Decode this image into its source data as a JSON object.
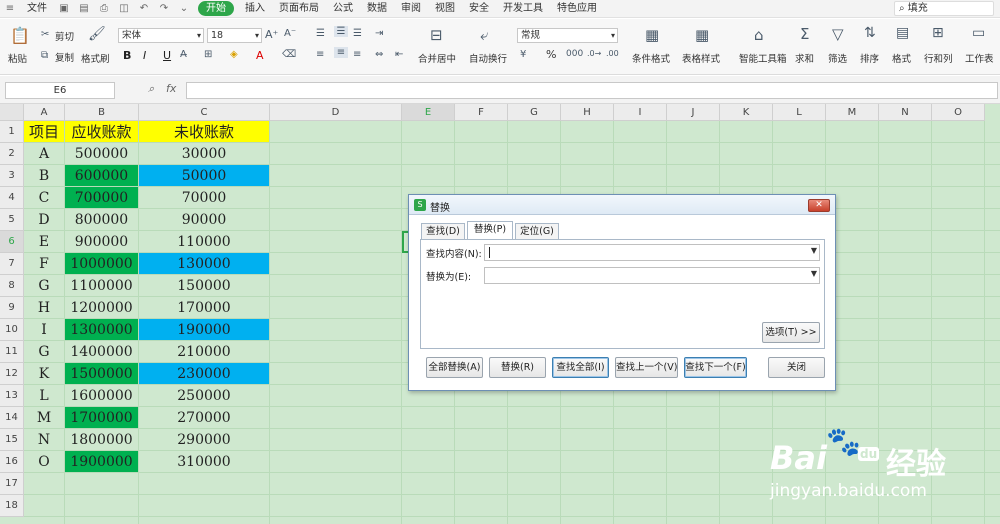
{
  "menubar": {
    "file": "文件",
    "items": [
      "开始",
      "插入",
      "页面布局",
      "公式",
      "数据",
      "审阅",
      "视图",
      "安全",
      "开发工具",
      "特色应用"
    ],
    "search": "填充"
  },
  "ribbon": {
    "paste": "粘贴",
    "cut": "剪切",
    "copy": "复制",
    "format_painter": "格式刷",
    "font": "宋体",
    "font_size": "18",
    "bold": "B",
    "italic": "I",
    "underline": "U",
    "merge": "合并居中",
    "wrap": "自动换行",
    "number_format": "常规",
    "percent": "%",
    "conditional": "条件格式",
    "table_style": "表格样式",
    "toolbox": "智能工具箱",
    "sum": "求和",
    "filter": "筛选",
    "sort": "排序",
    "format": "格式",
    "rowcol": "行和列",
    "sheet": "工作表"
  },
  "formula_bar": {
    "name_box": "E6",
    "fx": "fx",
    "value": ""
  },
  "grid": {
    "columns": [
      "A",
      "B",
      "C",
      "D",
      "E",
      "F",
      "G",
      "H",
      "I",
      "J",
      "K",
      "L",
      "M",
      "N",
      "O"
    ],
    "rows": [
      "1",
      "2",
      "3",
      "4",
      "5",
      "6",
      "7",
      "8",
      "9",
      "10",
      "11",
      "12",
      "13",
      "14",
      "15",
      "16",
      "17",
      "18"
    ],
    "header": [
      "项目",
      "应收账款",
      "未收账款"
    ],
    "data": [
      [
        "A",
        "500000",
        "30000"
      ],
      [
        "B",
        "600000",
        "50000"
      ],
      [
        "C",
        "700000",
        "70000"
      ],
      [
        "D",
        "800000",
        "90000"
      ],
      [
        "E",
        "900000",
        "110000"
      ],
      [
        "F",
        "1000000",
        "130000"
      ],
      [
        "G",
        "1100000",
        "150000"
      ],
      [
        "H",
        "1200000",
        "170000"
      ],
      [
        "I",
        "1300000",
        "190000"
      ],
      [
        "G",
        "1400000",
        "210000"
      ],
      [
        "K",
        "1500000",
        "230000"
      ],
      [
        "L",
        "1600000",
        "250000"
      ],
      [
        "M",
        "1700000",
        "270000"
      ],
      [
        "N",
        "1800000",
        "290000"
      ],
      [
        "O",
        "1900000",
        "310000"
      ]
    ],
    "green_b_rows": [
      1,
      2,
      5,
      8,
      10,
      12,
      14
    ],
    "blue_c_rows": [
      1,
      5,
      8,
      10
    ],
    "colors": {
      "header": "#ffff00",
      "green": "#00b050",
      "blue": "#00b0f0",
      "grid_bg": "#cfe8cf"
    }
  },
  "dialog": {
    "title": "替换",
    "tabs": [
      "查找(D)",
      "替换(P)",
      "定位(G)"
    ],
    "find_label": "查找内容(N):",
    "replace_label": "替换为(E):",
    "find_value": "",
    "replace_value": "",
    "options_button": "选项(T) >>",
    "buttons": [
      "全部替换(A)",
      "替换(R)",
      "查找全部(I)",
      "查找上一个(V)",
      "查找下一个(F)",
      "关闭"
    ]
  },
  "watermark": {
    "brand": "Bai",
    "brand2": "经验",
    "url": "jingyan.baidu.com"
  }
}
